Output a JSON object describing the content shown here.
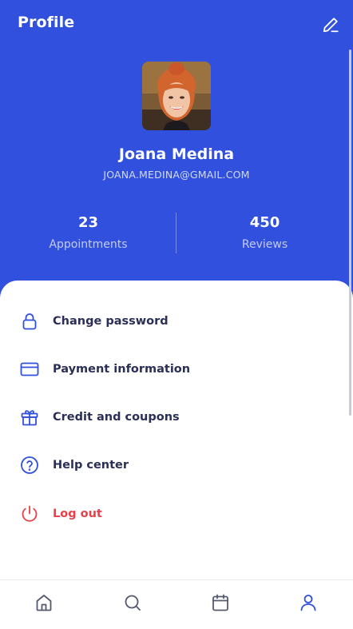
{
  "header": {
    "title": "Profile",
    "edit_icon": "pencil-icon"
  },
  "profile": {
    "name": "Joana Medina",
    "email": "JOANA.MEDINA@GMAIL.COM",
    "avatar_description": "avatar-photo"
  },
  "stats": [
    {
      "value": "23",
      "label": "Appointments"
    },
    {
      "value": "450",
      "label": "Reviews"
    }
  ],
  "menu": [
    {
      "label": "Change password",
      "icon": "lock-icon"
    },
    {
      "label": "Payment information",
      "icon": "credit-card-icon"
    },
    {
      "label": "Credit and coupons",
      "icon": "gift-icon"
    },
    {
      "label": "Help center",
      "icon": "help-circle-icon"
    },
    {
      "label": "Log out",
      "icon": "power-icon"
    }
  ],
  "nav": [
    {
      "icon": "home-icon",
      "active": false
    },
    {
      "icon": "search-icon",
      "active": false
    },
    {
      "icon": "calendar-icon",
      "active": false
    },
    {
      "icon": "user-icon",
      "active": true
    }
  ],
  "colors": {
    "brand": "#3050dd",
    "text": "#2b2f55",
    "danger": "#e9404a",
    "nav_icon": "#555a6e"
  }
}
